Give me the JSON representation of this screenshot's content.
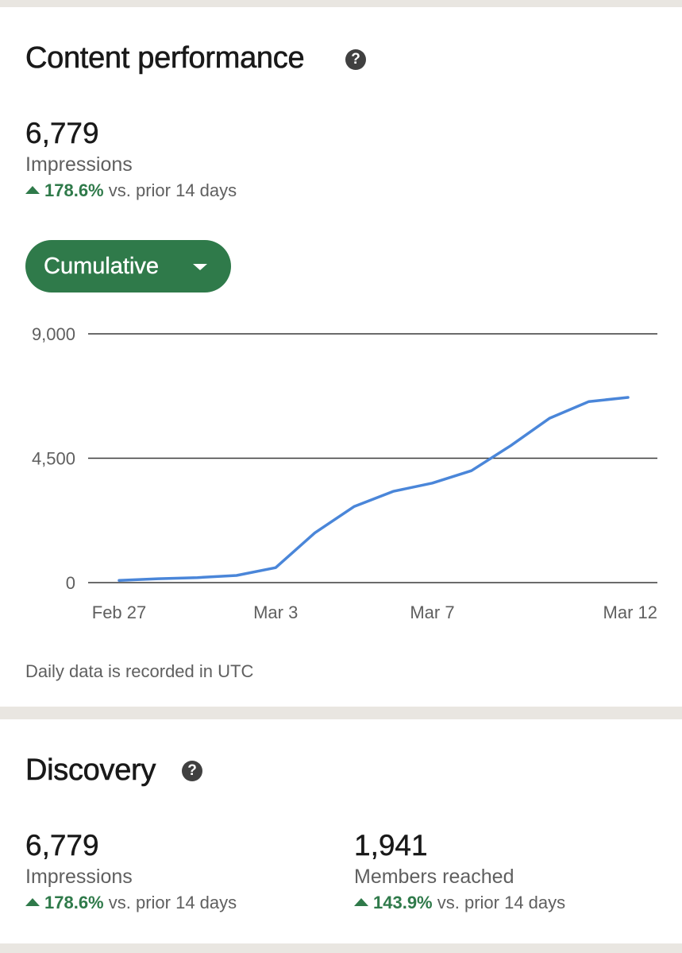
{
  "content_performance": {
    "title": "Content performance",
    "help": "?",
    "impressions": {
      "value": "6,779",
      "label": "Impressions",
      "change_pct": "178.6%",
      "change_suffix": " vs. prior 14 days"
    },
    "dropdown": {
      "label": "Cumulative"
    },
    "footnote": "Daily data is recorded in UTC"
  },
  "discovery": {
    "title": "Discovery",
    "help": "?",
    "impressions": {
      "value": "6,779",
      "label": "Impressions",
      "change_pct": "178.6%",
      "change_suffix": " vs. prior 14 days"
    },
    "members_reached": {
      "value": "1,941",
      "label": "Members reached",
      "change_pct": "143.9%",
      "change_suffix": " vs. prior 14 days"
    }
  },
  "chart_data": {
    "type": "line",
    "title": "",
    "xlabel": "",
    "ylabel": "",
    "ylim": [
      0,
      9000
    ],
    "y_ticks": [
      0,
      4500,
      9000
    ],
    "y_tick_labels": [
      "0",
      "4,500",
      "9,000"
    ],
    "x_tick_labels": [
      "Feb 27",
      "Mar 3",
      "Mar 7",
      "Mar 12"
    ],
    "x_tick_indices": [
      0,
      4,
      8,
      13
    ],
    "x": [
      "Feb 27",
      "Feb 28",
      "Mar 1",
      "Mar 2",
      "Mar 3",
      "Mar 4",
      "Mar 5",
      "Mar 6",
      "Mar 7",
      "Mar 8",
      "Mar 9",
      "Mar 10",
      "Mar 11",
      "Mar 12"
    ],
    "series": [
      {
        "values": [
          80,
          140,
          180,
          260,
          540,
          1800,
          2750,
          3300,
          3600,
          4050,
          4950,
          5950,
          6550,
          6700
        ]
      }
    ],
    "grid": true,
    "line_color": "#4a86d9"
  },
  "colors": {
    "accent_green": "#2f7a4a",
    "line_blue": "#4a86d9",
    "background": "#e9e6e1"
  }
}
